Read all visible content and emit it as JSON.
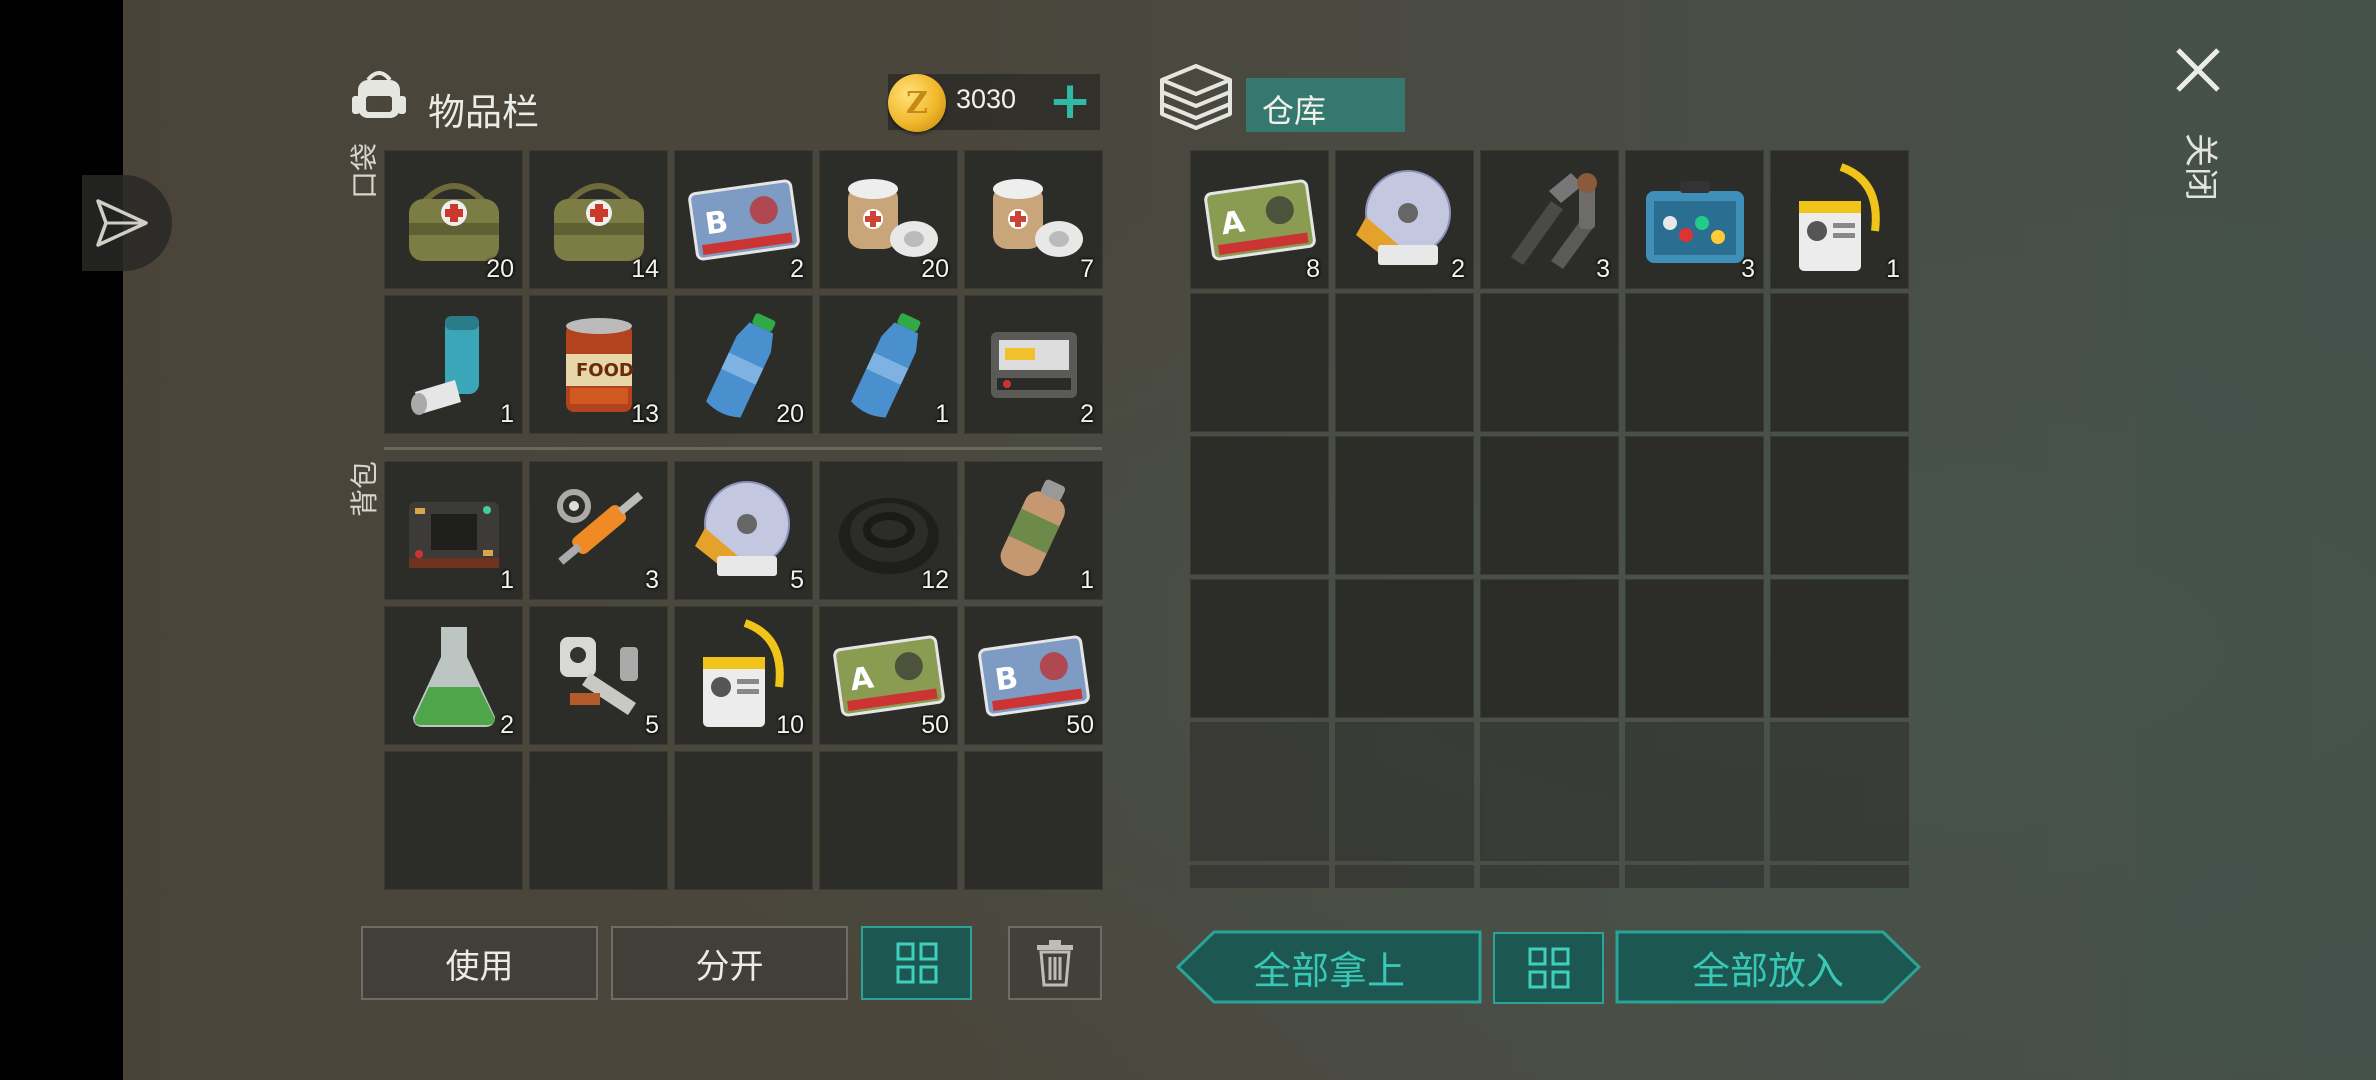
{
  "inventory": {
    "title": "物品栏",
    "coins": "3030",
    "pocket_label": "口袋",
    "backpack_label": "背包",
    "pocket_items": [
      {
        "icon": "medkit-bag-icon",
        "qty": "20"
      },
      {
        "icon": "medkit-bag-icon",
        "qty": "14"
      },
      {
        "icon": "sector-b-card-icon",
        "qty": "2"
      },
      {
        "icon": "bandage-roll-icon",
        "qty": "20"
      },
      {
        "icon": "bandage-roll-icon",
        "qty": "7"
      },
      {
        "icon": "inhaler-icon",
        "qty": "1"
      },
      {
        "icon": "food-can-icon",
        "qty": "13"
      },
      {
        "icon": "water-bottle-icon",
        "qty": "20"
      },
      {
        "icon": "water-bottle-icon",
        "qty": "1"
      },
      {
        "icon": "electronic-device-icon",
        "qty": "2"
      }
    ],
    "backpack_items": [
      {
        "icon": "circuit-chip-icon",
        "qty": "1"
      },
      {
        "icon": "hydraulic-cylinder-icon",
        "qty": "3"
      },
      {
        "icon": "disc-icon",
        "qty": "5"
      },
      {
        "icon": "rubber-hose-icon",
        "qty": "12"
      },
      {
        "icon": "gas-canister-icon",
        "qty": "1"
      },
      {
        "icon": "chemical-flask-icon",
        "qty": "2"
      },
      {
        "icon": "robot-arm-parts-icon",
        "qty": "5"
      },
      {
        "icon": "id-badge-icon",
        "qty": "10"
      },
      {
        "icon": "sector-a-card-icon",
        "qty": "50"
      },
      {
        "icon": "sector-b-card-icon",
        "qty": "50"
      },
      {
        "icon": "",
        "qty": ""
      },
      {
        "icon": "",
        "qty": ""
      },
      {
        "icon": "",
        "qty": ""
      },
      {
        "icon": "",
        "qty": ""
      },
      {
        "icon": "",
        "qty": ""
      }
    ],
    "buttons": {
      "use": "使用",
      "split": "分开"
    }
  },
  "warehouse": {
    "title": "仓库",
    "items": [
      {
        "icon": "sector-a-card-icon",
        "qty": "8"
      },
      {
        "icon": "disc-icon",
        "qty": "2"
      },
      {
        "icon": "metal-pipes-icon",
        "qty": "3"
      },
      {
        "icon": "toolbox-icon",
        "qty": "3"
      },
      {
        "icon": "id-badge-icon",
        "qty": "1"
      }
    ],
    "buttons": {
      "take_all": "全部拿上",
      "put_all": "全部放入"
    }
  },
  "close_label": "关闭",
  "colors": {
    "accent": "#2fb9a6",
    "teal_field": "#34786f",
    "slot": "#2c2c29"
  }
}
